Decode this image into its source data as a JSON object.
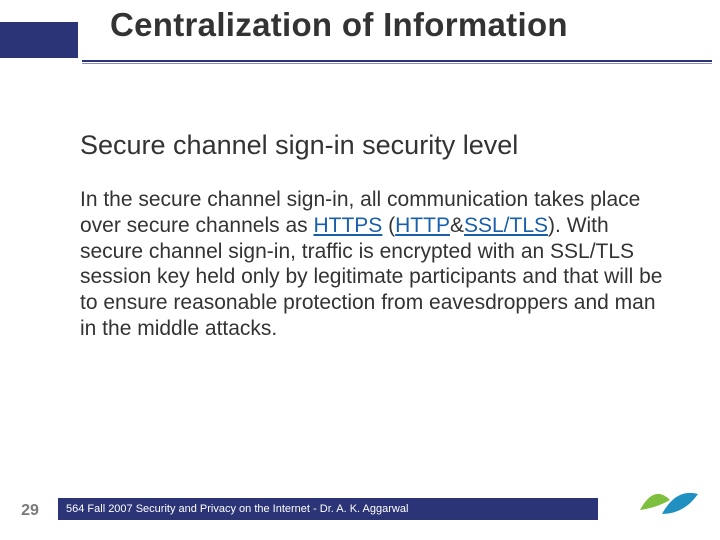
{
  "title": "Centralization of Information",
  "subhead": "Secure channel sign-in security level",
  "body": {
    "t0": " In the secure channel sign-in, all communication takes place over secure channels as ",
    "link_https": "HTTPS",
    "t1": " (",
    "link_http": "HTTP",
    "t2": "&",
    "link_ssl": "SSL/TLS",
    "t3": "). With secure channel sign-in, traffic is encrypted with an SSL/TLS session key held only by legitimate participants and that will be to ensure reasonable protection from eavesdroppers and man in the middle attacks."
  },
  "footer": {
    "page": "29",
    "text": "564 Fall 2007 Security and Privacy on the Internet - Dr. A. K. Aggarwal"
  }
}
